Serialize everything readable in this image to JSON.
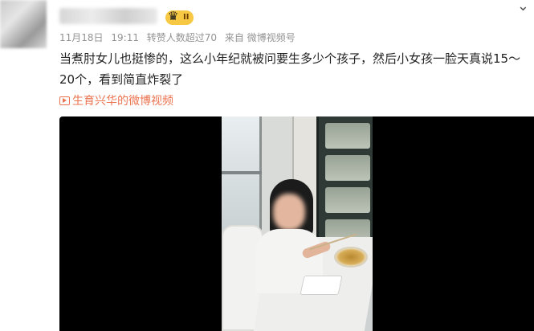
{
  "post": {
    "badge": {
      "level": "II",
      "icon": "crown-icon",
      "color": "#f7c843"
    },
    "meta": {
      "date": "11月18日",
      "time": "19:11",
      "likes": "转赞人数超过70",
      "source": "来自 微博视频号"
    },
    "text": "当煮肘女儿也挺惨的，这么小年纪就被问要生多少个孩子，然后小女孩一脸天真说15～20个，看到简直炸裂了",
    "video_link": {
      "icon": "video-play-icon",
      "label": "生育兴华的微博视频",
      "color": "#eb7350"
    },
    "menu_icon": "chevron-down-icon"
  }
}
